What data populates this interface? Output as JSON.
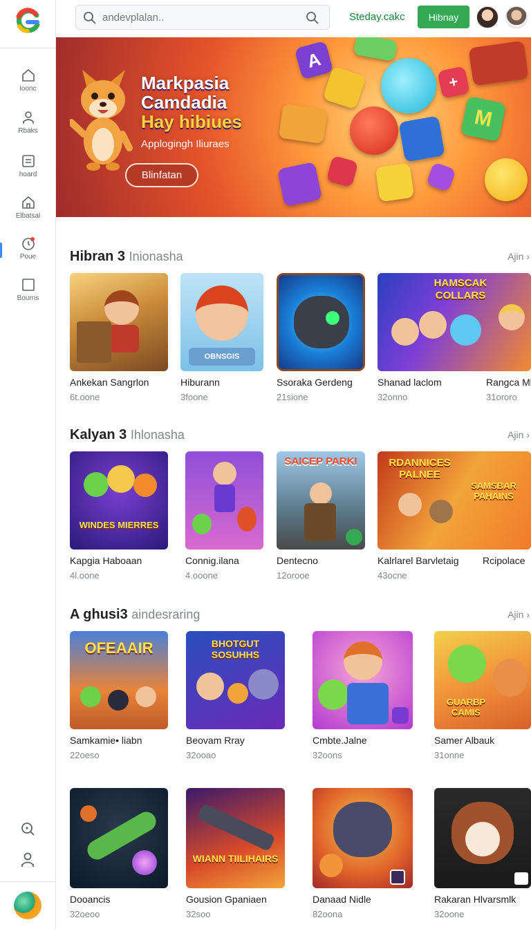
{
  "header": {
    "search_placeholder": "andevplalan..",
    "link": "Steday.cakc",
    "button": "Hibnay"
  },
  "sidebar": {
    "items": [
      {
        "label": "loonc",
        "icon": "home-icon"
      },
      {
        "label": "Rbaks",
        "icon": "person-icon"
      },
      {
        "label": "hoard",
        "icon": "library-icon"
      },
      {
        "label": "Elbatsal",
        "icon": "store-icon"
      },
      {
        "label": "Poue",
        "icon": "activity-icon"
      },
      {
        "label": "Bourns",
        "icon": "square-icon"
      }
    ]
  },
  "banner": {
    "title_line1": "Markpasia",
    "title_line2": "Camdadia",
    "title_line3": "Hay hibiues",
    "subtitle": "Applogingh Iliuraes",
    "button": "Blinfatan"
  },
  "sections": [
    {
      "title": "Hibran 3",
      "subtitle": "Inionasha",
      "more": "Ajin",
      "cards": [
        {
          "title": "Ankekan Sangrlon",
          "meta": "6t.oone"
        },
        {
          "title": "Hiburann",
          "meta": "3foone"
        },
        {
          "title": "Ssoraka Gerdeng",
          "meta": "21sione"
        },
        {
          "title": "Shanad laclom",
          "meta": "32onno"
        },
        {
          "title": "Rangca Ml",
          "meta": "31ororo"
        }
      ]
    },
    {
      "title": "Kalyan 3",
      "subtitle": "Ihlonasha",
      "more": "Ajin",
      "cards": [
        {
          "title": "Kapgia Haboaan",
          "meta": "4l.oone"
        },
        {
          "title": "Connig.ilana",
          "meta": "4.ooone"
        },
        {
          "title": "Dentecno",
          "meta": "12orooe"
        },
        {
          "title": "Kalrlarel Barvletaig",
          "meta": "43ocne"
        },
        {
          "title": "Rcipolace",
          "meta": ""
        }
      ]
    },
    {
      "title": "A ghusi3",
      "subtitle": "aindesraring",
      "more": "Ajin",
      "cards": [
        {
          "title": "Samkamie• liabn",
          "meta": "22oeso"
        },
        {
          "title": "Beovam Rray",
          "meta": "32ooao"
        },
        {
          "title": "Cmbte.Jalne",
          "meta": "32oons"
        },
        {
          "title": "Samer Albauk",
          "meta": "31onne"
        }
      ]
    },
    {
      "title": "",
      "subtitle": "",
      "more": "",
      "cards": [
        {
          "title": "Dooancis",
          "meta": "32oeoo"
        },
        {
          "title": "Gousion Gpaniaen",
          "meta": "32soo"
        },
        {
          "title": "Danaad Nidle",
          "meta": "82oona"
        },
        {
          "title": "Rakaran Hlvarsmlk",
          "meta": "32oone"
        }
      ]
    }
  ],
  "thumb_text": {
    "s1c4": "HAMSCAK COLLARS",
    "s1c2": "OBNSGIS",
    "s2c1": "WINDES MIERRES",
    "s2c3": "SAICEP PARKI",
    "s2c4a": "RDANNICES PALNEE",
    "s2c4b": "SAMSBAR PAHAINS",
    "s3c1": "OFEAAIR",
    "s3c2": "BHOTGUT SOSUHHS",
    "s3c4": "GUARBP CAMIS",
    "s4c2": "WIANN TIILIHAIRS"
  },
  "colors": {
    "accent_green": "#34a853",
    "link_green": "#188038",
    "banner_orange": "#e5532a"
  }
}
